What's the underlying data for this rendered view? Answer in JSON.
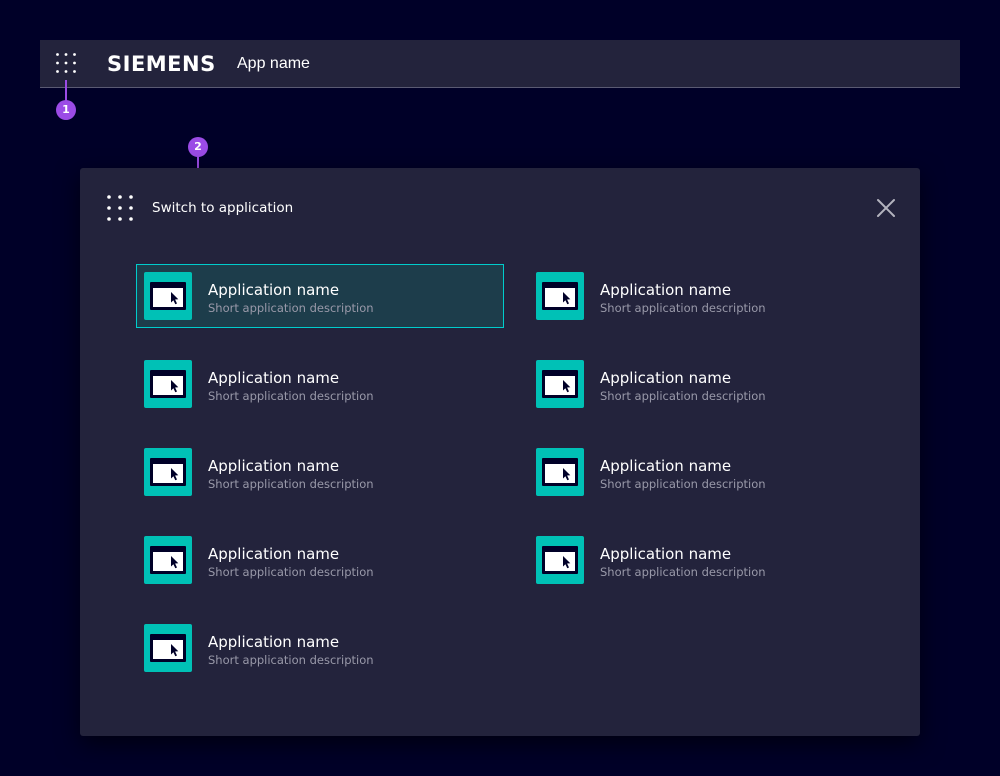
{
  "header": {
    "brand": "SIEMENS",
    "app_name": "App name",
    "launcher_icon": "grid-dots-icon"
  },
  "annotations": [
    "1",
    "2"
  ],
  "panel": {
    "title": "Switch to application",
    "icon": "grid-dots-icon",
    "close_icon": "close-icon",
    "apps": [
      {
        "name": "Application name",
        "description": "Short application description",
        "selected": true
      },
      {
        "name": "Application name",
        "description": "Short application description",
        "selected": false
      },
      {
        "name": "Application name",
        "description": "Short application description",
        "selected": false
      },
      {
        "name": "Application name",
        "description": "Short application description",
        "selected": false
      },
      {
        "name": "Application name",
        "description": "Short application description",
        "selected": false
      },
      {
        "name": "Application name",
        "description": "Short application description",
        "selected": false
      },
      {
        "name": "Application name",
        "description": "Short application description",
        "selected": false
      },
      {
        "name": "Application name",
        "description": "Short application description",
        "selected": false
      },
      {
        "name": "Application name",
        "description": "Short application description",
        "selected": false
      }
    ]
  },
  "colors": {
    "background": "#000028",
    "surface": "#23233c",
    "accent": "#00c1b6",
    "selection_border": "#00cccc",
    "annotation": "#9b4be6"
  }
}
